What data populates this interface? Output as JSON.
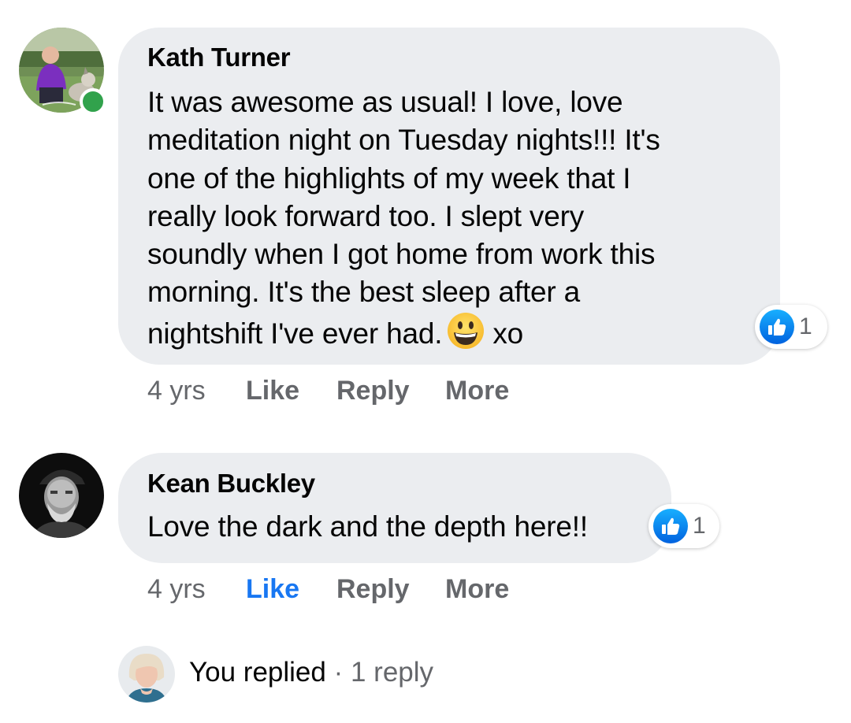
{
  "comments": [
    {
      "author": "Kath Turner",
      "online": true,
      "text_lines": [
        "It was awesome as usual! I love, love",
        "meditation night on Tuesday nights!!! It's",
        "one of the highlights of my week that I",
        "really look forward too. I slept very",
        "soundly when I got home from work this",
        "morning. It's the best sleep after a",
        "nightshift I've ever had."
      ],
      "text_suffix": "xo",
      "emoji": "grinning-face-emoji",
      "reaction": {
        "icon": "thumbs-up-icon",
        "count": "1"
      },
      "timestamp": "4 yrs",
      "actions": {
        "like": "Like",
        "reply": "Reply",
        "more": "More"
      },
      "liked_by_you": false
    },
    {
      "author": "Kean Buckley",
      "online": false,
      "text": "Love the dark and the depth here!!",
      "reaction": {
        "icon": "thumbs-up-icon",
        "count": "1"
      },
      "timestamp": "4 yrs",
      "actions": {
        "like": "Like",
        "reply": "Reply",
        "more": "More"
      },
      "liked_by_you": true
    }
  ],
  "reply_summary": {
    "label": "You replied",
    "separator": "·",
    "count_text": "1 reply"
  },
  "colors": {
    "bubble_bg": "#ebedf0",
    "text_primary": "#050505",
    "text_secondary": "#65676b",
    "like_active": "#1877f2",
    "online_green": "#31a24c"
  }
}
